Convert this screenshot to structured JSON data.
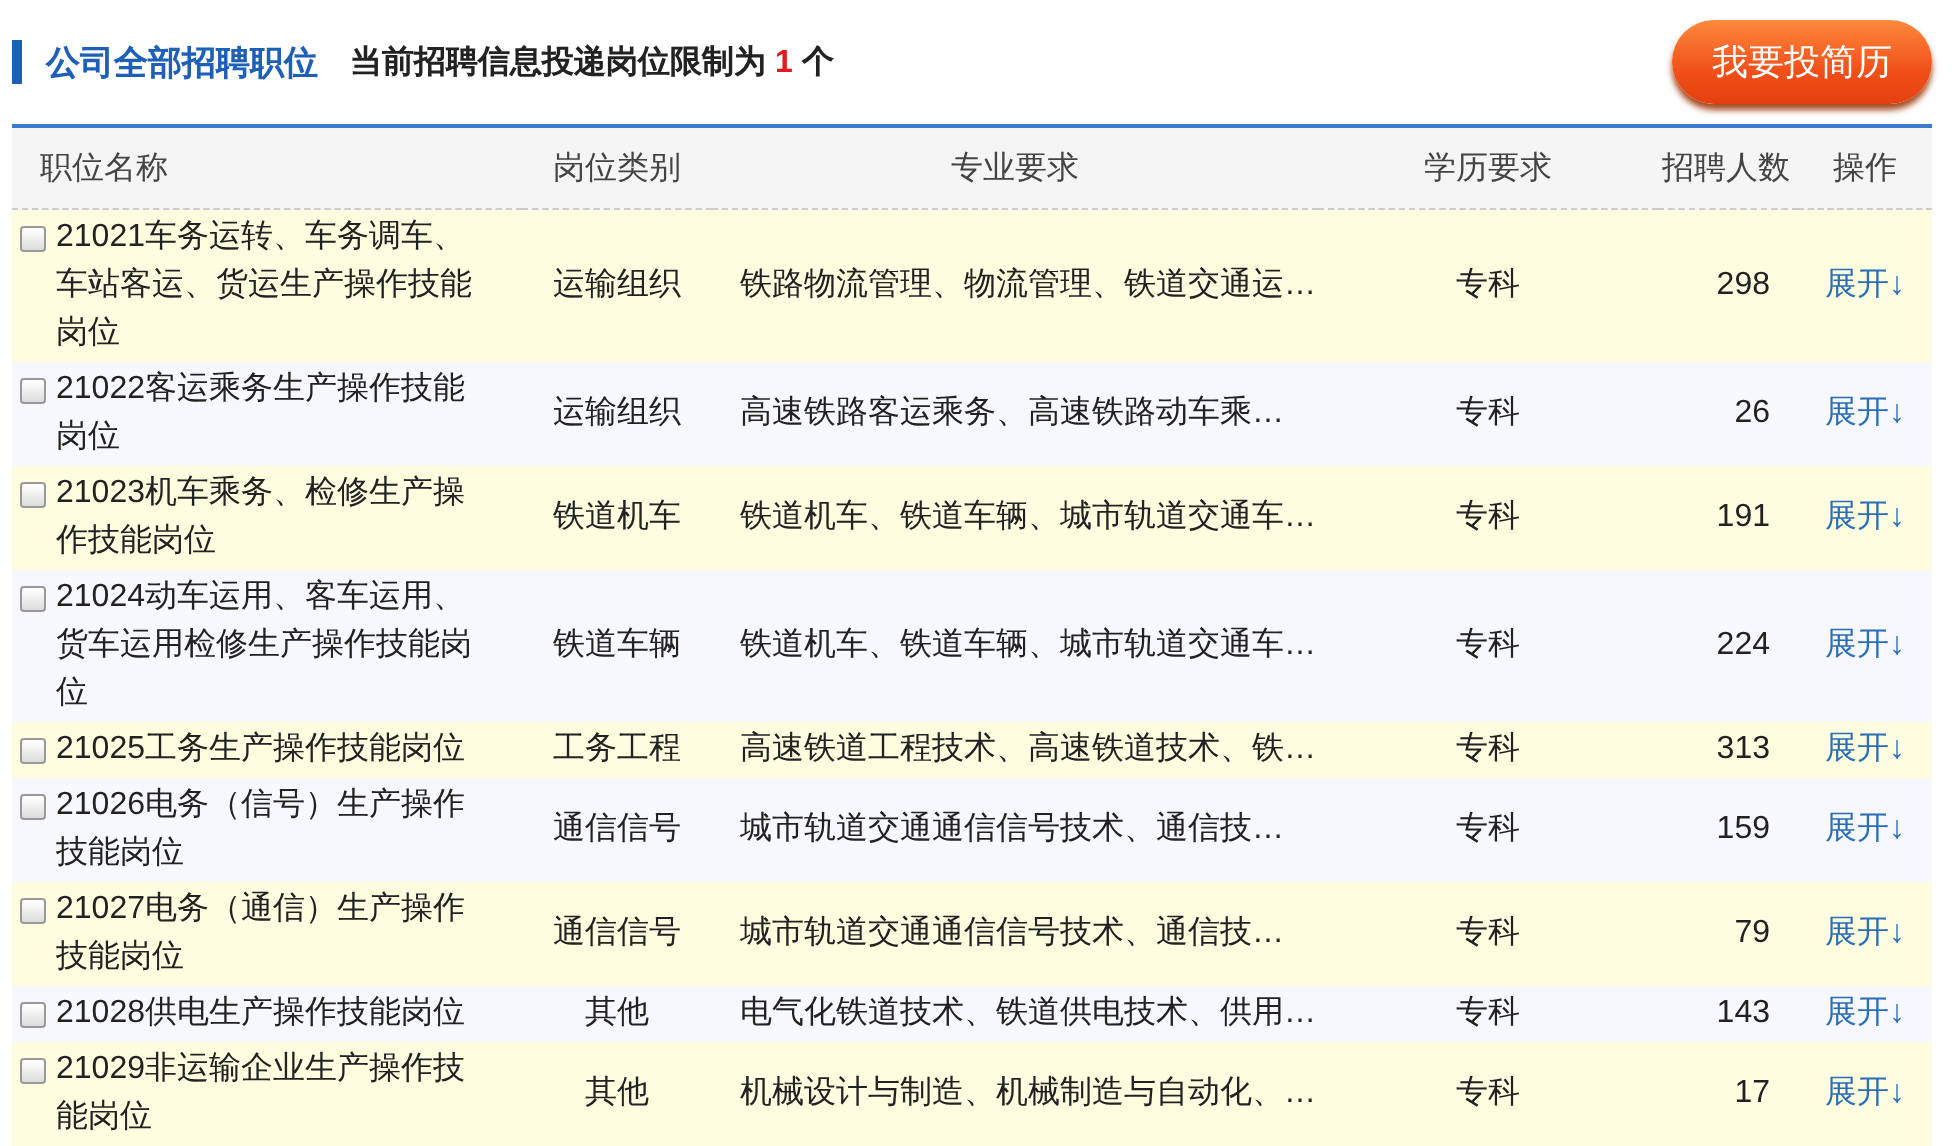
{
  "header": {
    "title": "公司全部招聘职位",
    "notice_prefix": "当前招聘信息投递岗位限制为",
    "notice_limit": "1",
    "notice_suffix": "个",
    "apply_button": "我要投简历"
  },
  "table": {
    "columns": [
      "职位名称",
      "岗位类别",
      "专业要求",
      "学历要求",
      "招聘人数",
      "操作"
    ],
    "rows": [
      {
        "checked": false,
        "name": "21021车务运转、车务调车、车站客运、货运生产操作技能岗位",
        "category": "运输组织",
        "major": "铁路物流管理、物流管理、铁道交通运…",
        "education": "专科",
        "count": "298",
        "action": "展开↓"
      },
      {
        "checked": false,
        "name": "21022客运乘务生产操作技能岗位",
        "category": "运输组织",
        "major": "高速铁路客运乘务、高速铁路动车乘…",
        "education": "专科",
        "count": "26",
        "action": "展开↓"
      },
      {
        "checked": false,
        "name": "21023机车乘务、检修生产操作技能岗位",
        "category": "铁道机车",
        "major": "铁道机车、铁道车辆、城市轨道交通车…",
        "education": "专科",
        "count": "191",
        "action": "展开↓"
      },
      {
        "checked": false,
        "name": "21024动车运用、客车运用、货车运用检修生产操作技能岗位",
        "category": "铁道车辆",
        "major": "铁道机车、铁道车辆、城市轨道交通车…",
        "education": "专科",
        "count": "224",
        "action": "展开↓"
      },
      {
        "checked": false,
        "name": "21025工务生产操作技能岗位",
        "category": "工务工程",
        "major": "高速铁道工程技术、高速铁道技术、铁…",
        "education": "专科",
        "count": "313",
        "action": "展开↓"
      },
      {
        "checked": false,
        "name": "21026电务（信号）生产操作技能岗位",
        "category": "通信信号",
        "major": "城市轨道交通通信信号技术、通信技…",
        "education": "专科",
        "count": "159",
        "action": "展开↓"
      },
      {
        "checked": false,
        "name": "21027电务（通信）生产操作技能岗位",
        "category": "通信信号",
        "major": "城市轨道交通通信信号技术、通信技…",
        "education": "专科",
        "count": "79",
        "action": "展开↓"
      },
      {
        "checked": false,
        "name": "21028供电生产操作技能岗位",
        "category": "其他",
        "major": "电气化铁道技术、铁道供电技术、供用…",
        "education": "专科",
        "count": "143",
        "action": "展开↓"
      },
      {
        "checked": false,
        "name": "21029非运输企业生产操作技能岗位",
        "category": "其他",
        "major": "机械设计与制造、机械制造与自动化、…",
        "education": "专科",
        "count": "17",
        "action": "展开↓"
      }
    ]
  }
}
